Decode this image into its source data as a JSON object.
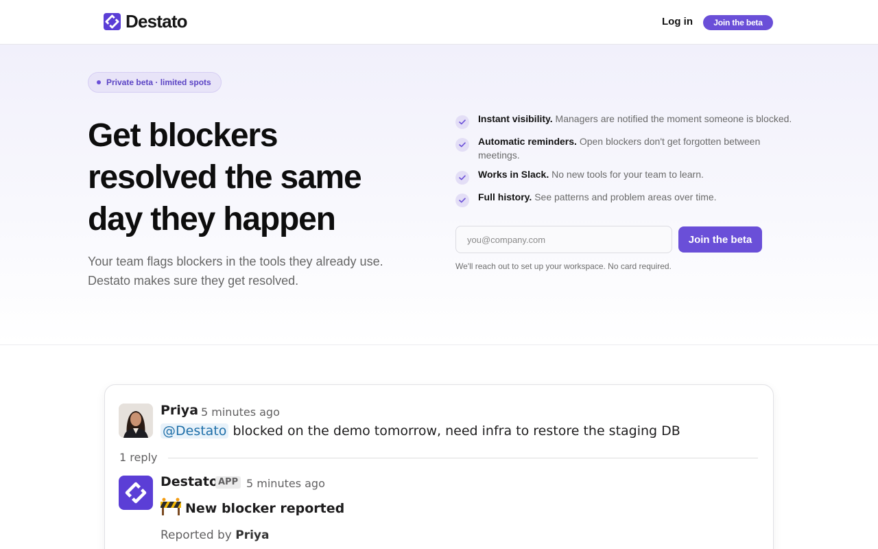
{
  "header": {
    "brand_name": "Destato",
    "login_label": "Log in",
    "beta_button_label": "Join the beta"
  },
  "hero": {
    "pill_text": "Private beta · limited spots",
    "title": "Get blockers resolved the same day they happen",
    "subtitle": "Your team flags blockers in the tools they already use. Destato makes sure they get resolved.",
    "features": [
      {
        "title": "Instant visibility.",
        "desc": "Managers are notified the moment someone is blocked."
      },
      {
        "title": "Automatic reminders.",
        "desc": "Open blockers don't get forgotten between meetings."
      },
      {
        "title": "Works in Slack.",
        "desc": "No new tools for your team to learn."
      },
      {
        "title": "Full history.",
        "desc": "See patterns and problem areas over time."
      }
    ],
    "email_placeholder": "you@company.com",
    "join_button_label": "Join the beta",
    "fine_print": "We'll reach out to set up your workspace. No card required."
  },
  "demo": {
    "message": {
      "author": "Priya",
      "timestamp": "5 minutes ago",
      "mention": "@Destato",
      "text": "blocked on the demo tomorrow, need infra to restore the staging DB"
    },
    "reply_count": "1 reply",
    "reply": {
      "author": "Destato",
      "badge": "APP",
      "timestamp": "5 minutes ago",
      "emoji_icon": "construction-barrier-icon",
      "title": "New blocker reported",
      "reported_prefix": "Reported by",
      "reported_by": "Priya"
    }
  },
  "colors": {
    "accent": "#6a4fd8",
    "logo": "#5b3ed6",
    "pill_bg": "#e8e4f8",
    "mention_bg": "#e8f2fa",
    "mention_text": "#1d6ea8"
  }
}
